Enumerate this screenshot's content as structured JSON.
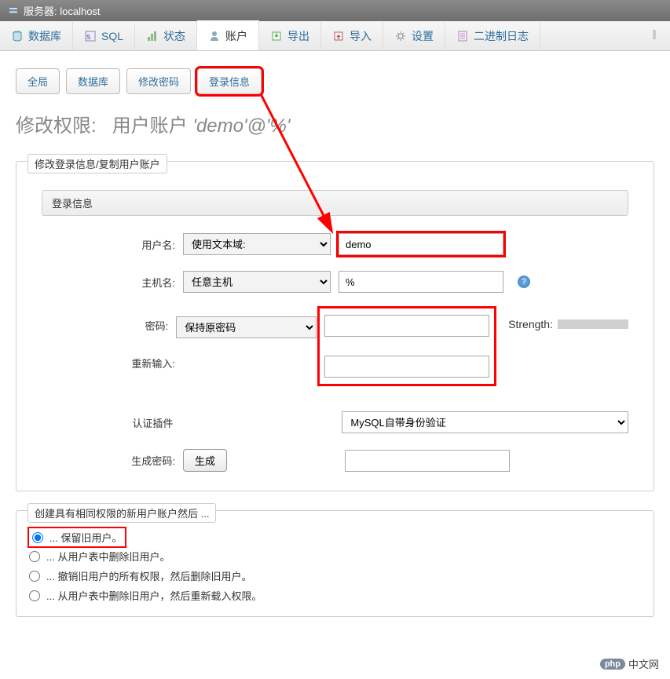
{
  "titlebar": {
    "label": "服务器: localhost"
  },
  "nav": {
    "items": [
      {
        "label": "数据库",
        "icon": "db"
      },
      {
        "label": "SQL",
        "icon": "sql"
      },
      {
        "label": "状态",
        "icon": "status"
      },
      {
        "label": "账户",
        "icon": "account",
        "active": true
      },
      {
        "label": "导出",
        "icon": "export"
      },
      {
        "label": "导入",
        "icon": "import"
      },
      {
        "label": "设置",
        "icon": "settings"
      },
      {
        "label": "二进制日志",
        "icon": "binlog"
      }
    ]
  },
  "subtabs": {
    "items": [
      {
        "label": "全局"
      },
      {
        "label": "数据库"
      },
      {
        "label": "修改密码"
      },
      {
        "label": "登录信息",
        "active": true
      }
    ]
  },
  "page_title": {
    "prefix": "修改权限:",
    "middle": "用户账户",
    "user": "'demo'@'%'"
  },
  "section1": {
    "legend": "修改登录信息/复制用户账户"
  },
  "login_group": {
    "heading": "登录信息"
  },
  "rows": {
    "username": {
      "label": "用户名:",
      "select": "使用文本域:",
      "value": "demo"
    },
    "hostname": {
      "label": "主机名:",
      "select": "任意主机",
      "value": "%"
    },
    "password": {
      "label": "密码:",
      "select": "保持原密码",
      "value": "",
      "strength_label": "Strength:"
    },
    "repeat": {
      "label": "重新输入:",
      "value": ""
    },
    "auth": {
      "label": "认证插件",
      "select": "MySQL自带身份验证"
    },
    "gen": {
      "label": "生成密码:",
      "button": "生成",
      "value": ""
    }
  },
  "section2": {
    "legend": "创建具有相同权限的新用户账户然后 ...",
    "options": [
      "... 保留旧用户。",
      "... 从用户表中删除旧用户。",
      "... 撤销旧用户的所有权限，然后删除旧用户。",
      "... 从用户表中删除旧用户，然后重新载入权限。"
    ],
    "selected": 0
  },
  "watermark": {
    "logo": "php",
    "text": "中文网"
  }
}
